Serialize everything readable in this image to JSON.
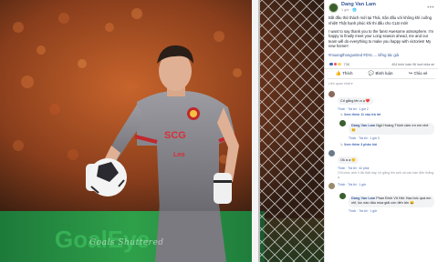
{
  "photo": {
    "watermark": "Goals Shuttered"
  },
  "post": {
    "author": "Dang Van Lam",
    "meta": "1 giờ · 🌐",
    "text_vi": "Bắt đầu thử thách mới tại Thái, trận đấu với không khí cuồng nhiệt! Thật hạnh phúc khi thi đấu cho CLB mới!",
    "text_en": "I want to say thank you to the fans! Awesome atmosphere. I'm happy to finally meet your Long season ahead, me and our team will do everything to make you happy with victories! My new home!!",
    "tags": "#muangthongunited #DVL ... tiếng tác giả",
    "extra": "Xem bản dịch · Xếp hạng bản dịch",
    "reactions_count": "73K",
    "comments_shares": "404 bình luận 96 lượt chia sẻ",
    "translate": "Xem bản dịch"
  },
  "actions": {
    "like": "Thích",
    "comment": "Bình luận",
    "share": "Chia sẻ"
  },
  "sort_label": "Liên quan nhất ▾",
  "comments": [
    {
      "author": "",
      "text": "Cố gắng lên a ạ ❤️",
      "actions": "Thích · Trả lời · 1 giờ",
      "reacts": "2",
      "color": "#8a6a5a"
    },
    {
      "view_replies": "Xem thêm 11 câu trả lời"
    },
    {
      "author": "Dang Van Lam",
      "text": "Ngô Hoàng Thịnh cảm ơn em nhé 😊",
      "actions": "Thích · Trả lời · 1 giờ",
      "reacts": "3",
      "reply": true,
      "color": "#3a5f2a"
    },
    {
      "view_replies": "Xem thêm 3 phản hồi"
    },
    {
      "author": "",
      "text": "Ok a ạ 🙂",
      "actions": "Thích · Trả lời · 42 phút",
      "reacts": "",
      "color": "#6a7a8a"
    },
    {
      "plain": "Chỉ chúc anh lì đá thật hay, cố gắng lên anh và các bạn đến thắng ạ"
    },
    {
      "author": "",
      "text": "",
      "actions": "Thích · Trả lời · 1 giờ",
      "reacts": "",
      "color": "#9a8a6a"
    },
    {
      "author": "Dang Van Lam",
      "text": "Phan Đình Vũ Hải: Hạc bốc quá em nhỉ, lúc nào đấu mùa giải còn đến lấn 😄",
      "actions": "Thích · Trả lời · 1 giờ",
      "reacts": "",
      "reply": true,
      "color": "#3a5f2a"
    }
  ],
  "colors": {
    "facebook_blue": "#4267b2",
    "link": "#365899",
    "jersey": "#8a8a8e",
    "crowd": "#c0622a"
  }
}
